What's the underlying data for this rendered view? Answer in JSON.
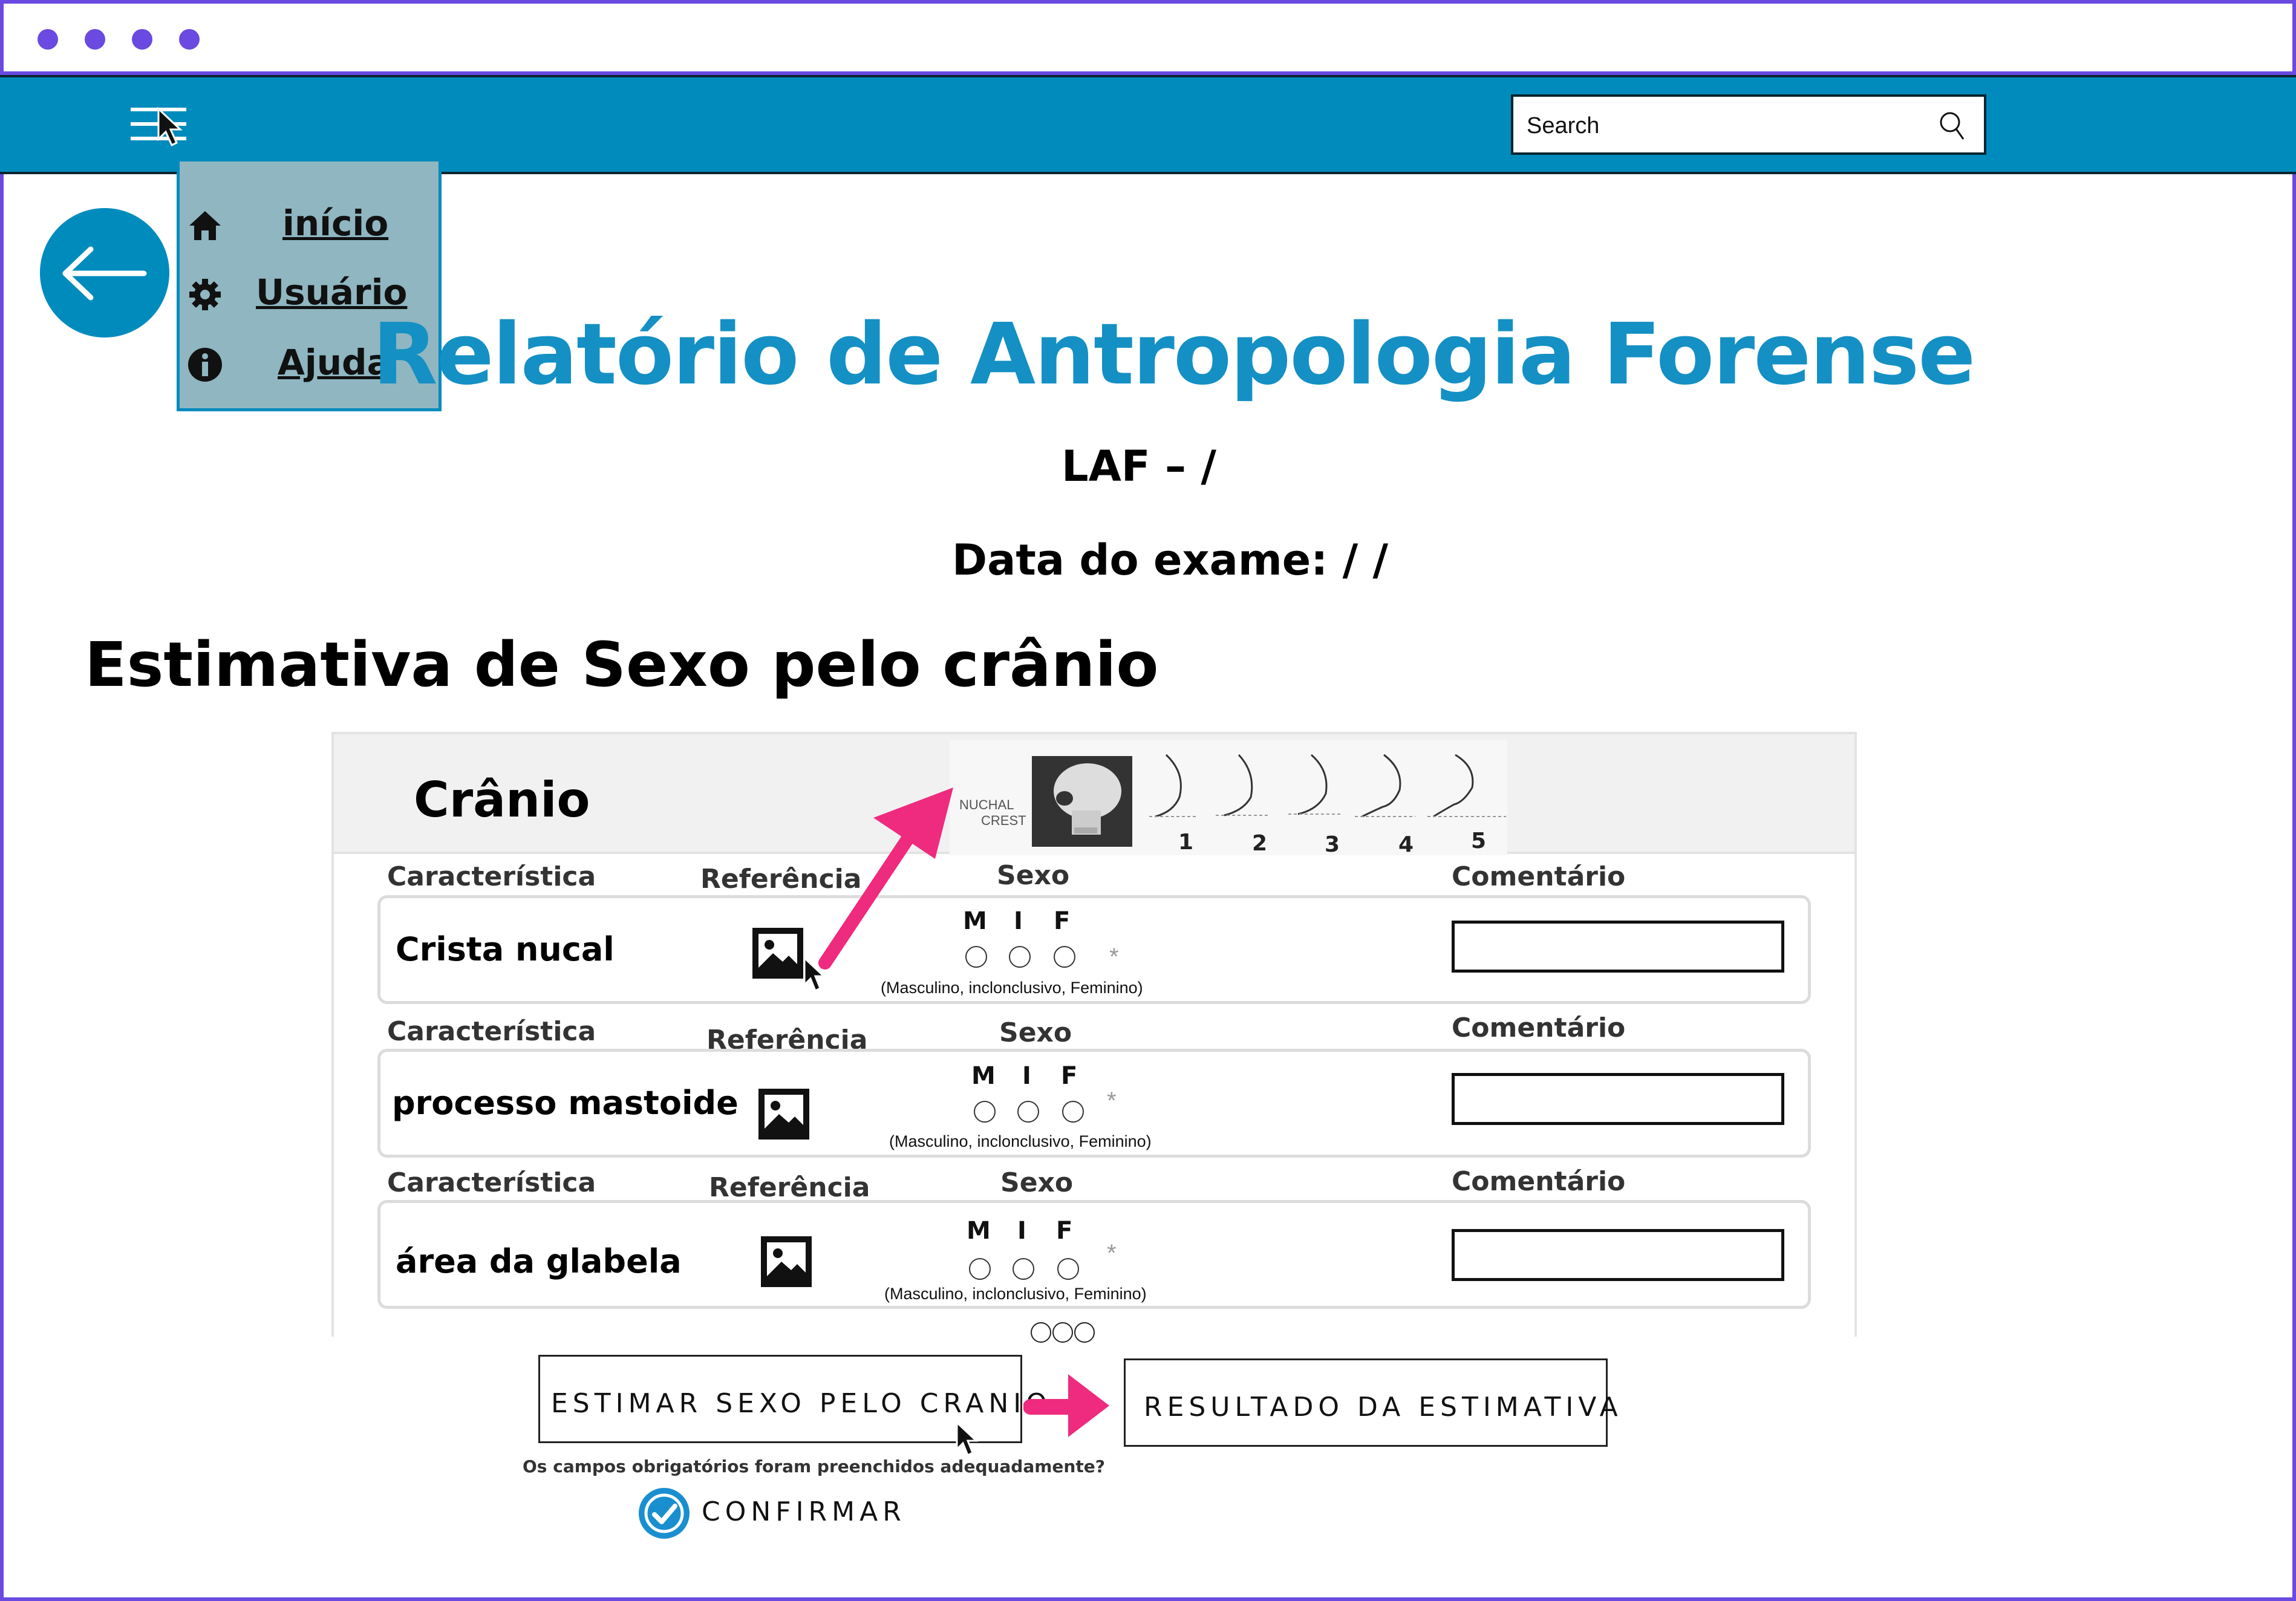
{
  "colors": {
    "frame": "#6a4ae0",
    "navbar": "#008bbd",
    "title": "#1490c4",
    "menu_bg": "#8fb6c1",
    "arrow": "#ee2b7e",
    "check": "#1a8fd0"
  },
  "search": {
    "placeholder": "Search",
    "icon": "search-icon"
  },
  "menu": {
    "items": [
      {
        "label": "início",
        "icon": "home-icon"
      },
      {
        "label": "Usuário ",
        "icon": "gear-icon"
      },
      {
        "label": "Ajuda",
        "icon": "info-icon"
      }
    ]
  },
  "page": {
    "title": "Relatório de Antropologia Forense",
    "laf": "LAF –   /",
    "exam_date": "Data do exame:  / /",
    "section_title": "Estimativa de Sexo pelo crânio"
  },
  "card": {
    "title": "Crânio",
    "reference_image": {
      "label_line1": "NUCHAL",
      "label_line2": "CREST",
      "scale": [
        "1",
        "2",
        "3",
        "4",
        "5"
      ]
    },
    "columns": {
      "characteristic": "Característica",
      "reference": "Referência",
      "sex": "Sexo",
      "comment": "Comentário"
    },
    "sex_options": {
      "m": "M",
      "i": "I",
      "f": "F",
      "required": "*",
      "hint": "(Masculino, inclonclusivo, Feminino)"
    },
    "rows": [
      {
        "name": "Crista nucal"
      },
      {
        "name": "processo mastoide"
      },
      {
        "name": "área da glabela"
      }
    ]
  },
  "actions": {
    "estimate_button": "ESTIMAR SEXO PELO CRANIO",
    "result_button": "RESULTADO DA ESTIMATIVA",
    "question": "Os campos obrigatórios foram preenchidos adequadamente?",
    "confirm": "CONFIRMAR"
  }
}
